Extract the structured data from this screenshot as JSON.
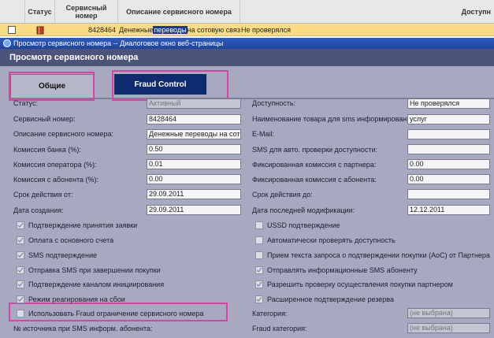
{
  "grid": {
    "headers": {
      "status": "Статус",
      "number": "Сервисный номер",
      "description": "Описание сервисного номера",
      "availability": "Доступн"
    },
    "row": {
      "number": "8428464",
      "desc_prefix": "Денежные ",
      "desc_selected": "переводы",
      "desc_suffix": " на сотовую связ",
      "availability": "Не проверялся"
    }
  },
  "dialog": {
    "window_title": "Просмотр сервисного номера -- Диалоговое окно веб-страницы",
    "heading": "Просмотр сервисного номера",
    "tabs": {
      "general": "Общие",
      "fraud": "Fraud Control"
    }
  },
  "fields": {
    "status": {
      "label": "Статус:",
      "value": "Активный"
    },
    "number": {
      "label": "Сервисный номер:",
      "value": "8428464"
    },
    "description": {
      "label": "Описание сервисного номера:",
      "value": "Денежные переводы на сотовую"
    },
    "bank_fee": {
      "label": "Комиссия банка (%):",
      "value": "0.50"
    },
    "operator_fee": {
      "label": "Комиссия оператора (%):",
      "value": "0.01"
    },
    "subscriber_fee": {
      "label": "Комиссия с абонента (%):",
      "value": "0.00"
    },
    "valid_from": {
      "label": "Срок действия от:",
      "value": "29.09.2011"
    },
    "created": {
      "label": "Дата создания:",
      "value": "29.09.2011"
    },
    "availability": {
      "label": "Доступность:",
      "value": "Не проверялся"
    },
    "sms_product_name": {
      "label": "Наименование товара для sms информирования:",
      "value": "услуг"
    },
    "email": {
      "label": "E-Mail:",
      "value": ""
    },
    "sms_check": {
      "label": "SMS для авто. проверки доступности:",
      "value": ""
    },
    "partner_fixed_fee": {
      "label": "Фиксированная комиссия с партнера:",
      "value": "0.00"
    },
    "subscriber_fixed_fee": {
      "label": "Фиксированная комиссия с абонента:",
      "value": "0.00"
    },
    "valid_to": {
      "label": "Срок действия до:",
      "value": ""
    },
    "modified": {
      "label": "Дата последней модификации:",
      "value": "12.12.2011"
    },
    "category": {
      "label": "Категория:",
      "value": "(не выбрана)"
    },
    "fraud_category": {
      "label": "Fraud категория:",
      "value": "(не выбрана)"
    },
    "sms_source": {
      "label": "№ источника при SMS информ. абонента:"
    }
  },
  "checkboxes": {
    "left": [
      {
        "label": "Подтверждение принятия заявки",
        "checked": true
      },
      {
        "label": "Оплата с основного счета",
        "checked": true
      },
      {
        "label": "SMS подтверждение",
        "checked": true
      },
      {
        "label": "Отправка SMS при завершении покупки",
        "checked": true
      },
      {
        "label": "Подтверждение каналом инициирования",
        "checked": true
      },
      {
        "label": "Режим реагирования на сбои",
        "checked": true
      },
      {
        "label": "Использовать Fraud ограничение сервисного номера",
        "checked": false
      }
    ],
    "right": [
      {
        "label": "USSD подтверждение",
        "checked": false
      },
      {
        "label": "Автоматически проверять доступность",
        "checked": false
      },
      {
        "label": "Прием текста запроса о подтверждении покупки (АоС) от Партнера",
        "checked": false
      },
      {
        "label": "Отправлять информационные SMS абоненту",
        "checked": true
      },
      {
        "label": "Разрешить проверку осуществления покупки партнером",
        "checked": true
      },
      {
        "label": "Расширенное подтверждение резерва",
        "checked": true
      }
    ]
  },
  "colors": {
    "highlight": "#e040a6",
    "dialog_bg": "#a6a9c0",
    "heading_bg": "#4c5579",
    "tab_active_bg": "#0f2a6e",
    "row_bg": "#fbdc86"
  }
}
